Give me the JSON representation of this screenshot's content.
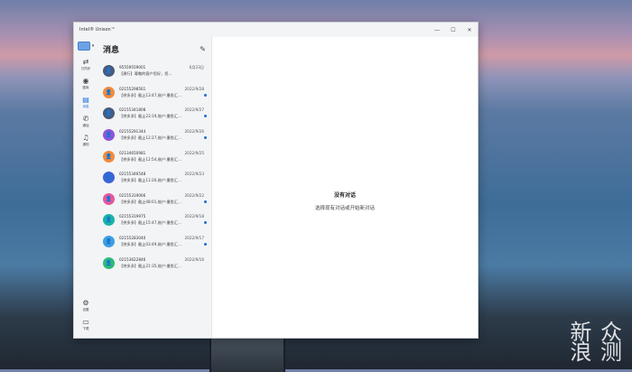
{
  "window": {
    "title": "Intel® Unison™",
    "controls": [
      "—",
      "☐",
      "✕"
    ]
  },
  "nav": {
    "items": [
      {
        "icon": "⇄",
        "label": "已同步"
      },
      {
        "icon": "◉",
        "label": "图库"
      },
      {
        "icon": "▤",
        "label": "消息"
      },
      {
        "icon": "✆",
        "label": "通话"
      },
      {
        "icon": "♫",
        "label": "通知"
      }
    ],
    "bottom": [
      {
        "icon": "⚙",
        "label": "设置"
      },
      {
        "icon": "▭",
        "label": "下载"
      }
    ]
  },
  "list": {
    "title": "消息",
    "compose_icon": "✎",
    "conversations": [
      {
        "number": "95559559001",
        "date": "6月23日",
        "preview": "【建行】尊敬的客户您好，您...",
        "color": "#4a5a7a",
        "unread": false
      },
      {
        "number": "02155298561",
        "date": "2022/9/28",
        "preview": "【拼多多】截止13:47,账户:墨鱼汇...",
        "color": "#f28b3c",
        "unread": true
      },
      {
        "number": "02155341808",
        "date": "2022/9/27",
        "preview": "【拼多多】截止23:19,账户:墨鱼汇...",
        "color": "#4a5a7a",
        "unread": true
      },
      {
        "number": "02155291344",
        "date": "2022/9/26",
        "preview": "【拼多多】截止12:27,账户:墨鱼汇...",
        "color": "#8e54d9",
        "unread": true
      },
      {
        "number": "02134650981",
        "date": "2022/9/25",
        "preview": "【拼多多】截止12:54,账户:墨鱼汇...",
        "color": "#f28b3c",
        "unread": false
      },
      {
        "number": "02155346548",
        "date": "2022/9/23",
        "preview": "【拼多多】截止11:26,账户:墨鱼汇...",
        "color": "#3e63d6",
        "unread": false
      },
      {
        "number": "02155319066",
        "date": "2022/9/22",
        "preview": "【拼多多】截止08:01,账户:墨鱼汇...",
        "color": "#e8579a",
        "unread": true
      },
      {
        "number": "02155319975",
        "date": "2022/9/18",
        "preview": "【拼多多】截止15:47,账户:墨鱼汇...",
        "color": "#17b4a6",
        "unread": true
      },
      {
        "number": "02155283040",
        "date": "2022/9/17",
        "preview": "【拼多多】截止03:49,账户:墨鱼汇...",
        "color": "#3fa0e0",
        "unread": true
      },
      {
        "number": "02153622846",
        "date": "2022/9/16",
        "preview": "【拼多多】截止21:35,账户:墨鱼汇...",
        "color": "#2dbb78",
        "unread": false
      }
    ]
  },
  "main": {
    "empty_title": "没有对话",
    "empty_subtitle": "选择现有对话或开始新对话"
  },
  "watermark": {
    "line1": "新 众",
    "line2": "浪 测"
  }
}
